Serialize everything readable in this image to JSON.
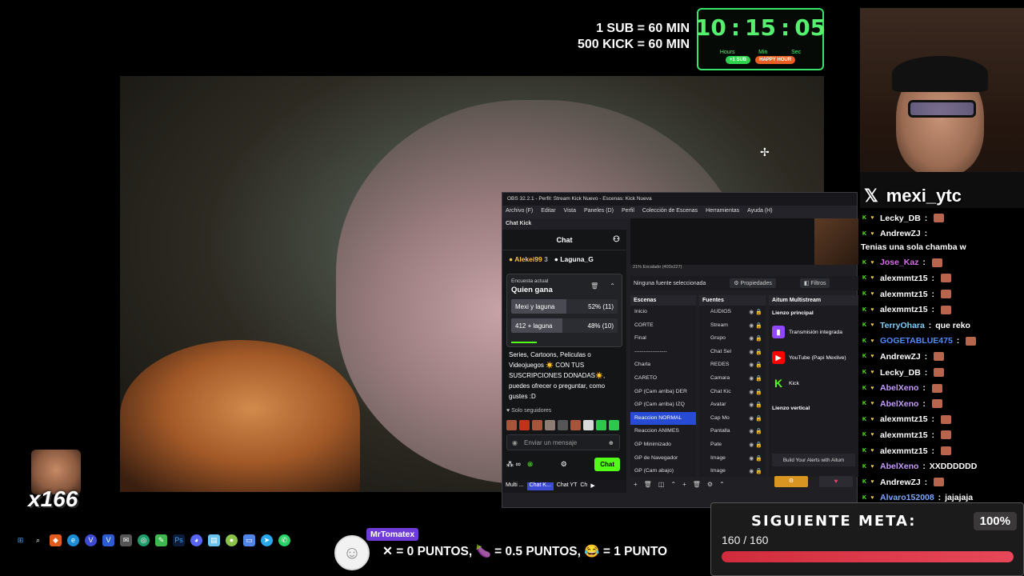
{
  "overlay": {
    "sub_line1": "1 SUB = 60 MIN",
    "sub_line2": "500 KICK = 60 MIN",
    "timer": {
      "hours": "10",
      "minutes": "15",
      "seconds": "05",
      "hours_lbl": "Hours",
      "min_lbl": "Min",
      "sec_lbl": "Sec",
      "pill1": "+1 SUB",
      "pill2": "HAPPY HOUR"
    },
    "handle": "mexi_ytc",
    "emote_count": "x166"
  },
  "side_chat": [
    {
      "user": "Lecky_DB",
      "color": "#ffffff",
      "text": ""
    },
    {
      "user": "AndrewZJ",
      "color": "#ffffff",
      "text": "Tenias una sola chamba w",
      "wrap": true
    },
    {
      "user": "Jose_Kaz",
      "color": "#d86ee8",
      "text": ""
    },
    {
      "user": "alexmmtz15",
      "color": "#ffffff",
      "text": ""
    },
    {
      "user": "alexmmtz15",
      "color": "#ffffff",
      "text": ""
    },
    {
      "user": "alexmmtz15",
      "color": "#ffffff",
      "text": ""
    },
    {
      "user": "TerryOhara",
      "color": "#7ed1ff",
      "text": "que reko"
    },
    {
      "user": "GOGETABLUE475",
      "color": "#4f8bff",
      "text": ""
    },
    {
      "user": "AndrewZJ",
      "color": "#ffffff",
      "text": ""
    },
    {
      "user": "Lecky_DB",
      "color": "#ffffff",
      "text": ""
    },
    {
      "user": "AbelXeno",
      "color": "#c59cff",
      "text": ""
    },
    {
      "user": "AbelXeno",
      "color": "#c59cff",
      "text": ""
    },
    {
      "user": "alexmmtz15",
      "color": "#ffffff",
      "text": ""
    },
    {
      "user": "alexmmtz15",
      "color": "#ffffff",
      "text": ""
    },
    {
      "user": "alexmmtz15",
      "color": "#ffffff",
      "text": ""
    },
    {
      "user": "AbelXeno",
      "color": "#c59cff",
      "text": "XXDDDDDD"
    },
    {
      "user": "AndrewZJ",
      "color": "#ffffff",
      "text": ""
    },
    {
      "user": "Alvaro152008",
      "color": "#7ea7ff",
      "text": "jajajaja"
    }
  ],
  "obs": {
    "title": "OBS 32.2.1 - Perfil: Stream Kick Nuevo - Escenas: Kick Nueva",
    "menu": [
      "Archivo (F)",
      "Editar",
      "Vista",
      "Paneles (D)",
      "Perfil",
      "Colección de Escenas",
      "Herramientas",
      "Ayuda (H)"
    ],
    "dock_title": "Chat Kick",
    "zoom": "21%   Escalado (403x227)",
    "no_source": "Ninguna fuente seleccionada",
    "properties": "Propiedades",
    "filters": "Filtros",
    "scenes_hdr": "Escenas",
    "scenes": [
      "Inicio",
      "CORTE",
      "Final",
      "------------------",
      "Charla",
      "CARETO",
      "GP (Cam arriba) DER",
      "GP (Cam arriba) IZQ",
      "Reaccion NORMAL",
      "Reaccion ANIMES",
      "GP Minimizado",
      "GP de Navegador",
      "GP (Cam abajo)"
    ],
    "selected_scene": 8,
    "sources_hdr": "Fuentes",
    "sources": [
      "AUDIOS",
      "Stream",
      "Grupo",
      "Chat Sel",
      "REDES",
      "Camara",
      "Chat Kic",
      "Avatar",
      "Cap Mo",
      "Pantalla",
      "Pate",
      "Image",
      "Image"
    ],
    "multistream_hdr": "Aitum Multistream",
    "lienzo_principal": "Lienzo principal",
    "ms_items": [
      {
        "name": "Transmisión integrada",
        "icon": "twitch-icon",
        "color": "#9146ff",
        "glyph": "▮"
      },
      {
        "name": "YouTube (Papi Mexlive)",
        "icon": "youtube-icon",
        "color": "#ff0000",
        "glyph": "▶"
      },
      {
        "name": "Kick",
        "icon": "kick-icon",
        "color": "#53fc18",
        "glyph": "K"
      }
    ],
    "lienzo_vertical": "Lienzo vertical",
    "alerts_btn": "Build Your Alerts with Aitum",
    "tabs": [
      "Multi ...",
      "Chat K...",
      "Chat YT",
      "Ch"
    ],
    "active_tab": 1
  },
  "kick_chat": {
    "header": "Chat",
    "leader1_name": "Alekei99",
    "leader1_count": "3",
    "leader2_name": "Laguna_G",
    "poll_label": "Encuesta actual",
    "poll_question": "Quien gana",
    "options": [
      {
        "label": "Mexi y laguna",
        "pct": "52% (11)",
        "fill": 52
      },
      {
        "label": "412 + laguna",
        "pct": "48% (10)",
        "fill": 48
      }
    ],
    "message": "Series, Cartoons, Peliculas o Videojuegos ☀️ CON TUS SUSCRIPCIONES DONADAS☀️, puedes ofrecer o preguntar, como gustes :D",
    "followers_only": "Solo seguidores",
    "input_placeholder": "Enviar un mensaje",
    "chat_button": "Chat"
  },
  "goal": {
    "title": "SIGUIENTE META:",
    "pct": "100%",
    "count": "160 / 160",
    "progress": 1.0
  },
  "points": {
    "name": "MrTomatex",
    "text": "✕ = 0 PUNTOS, 🍆 = 0.5 PUNTOS, 😂 = 1 PUNTO"
  },
  "colors": {
    "kick_green": "#53fc18",
    "timer_green": "#56f06e",
    "goal_red": "#d02c3d",
    "obs_selected": "#284bd6"
  }
}
